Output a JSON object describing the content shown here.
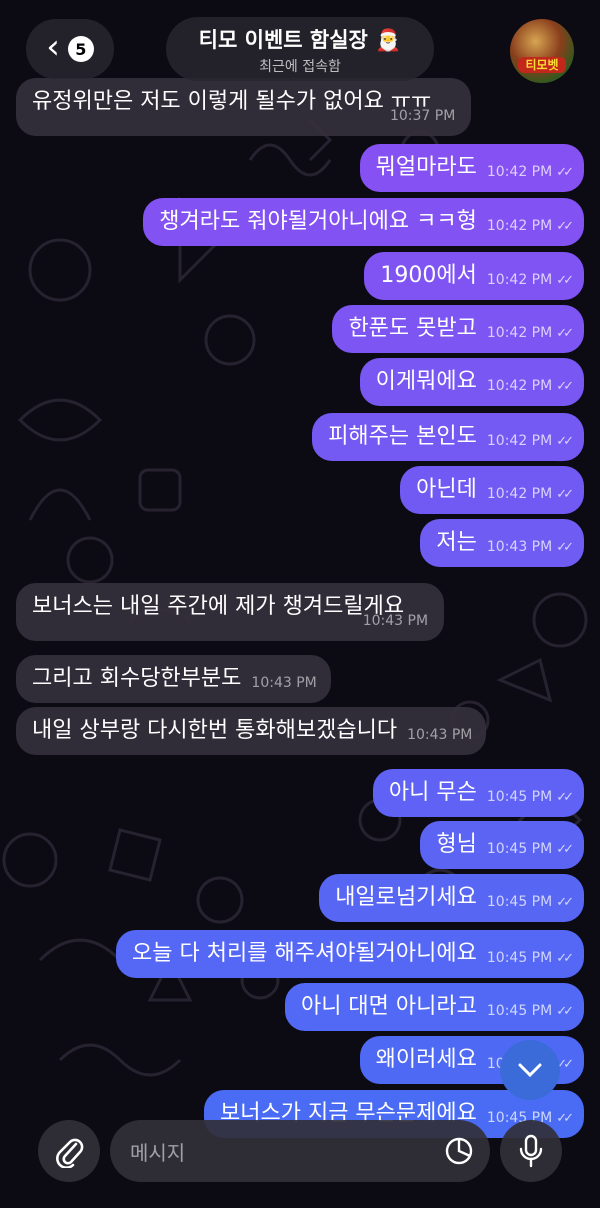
{
  "header": {
    "back_count": "5",
    "title": "티모 이벤트 함실장 🎅",
    "status": "최근에 접속함",
    "avatar_text": "티모벳"
  },
  "messages": [
    {
      "dir": "in",
      "text": "유정위만은 저도 이렇게 될수가 없어요 ㅠㅠ",
      "time": "10:37 PM"
    },
    {
      "dir": "out",
      "text": "뭐얼마라도",
      "time": "10:42 PM"
    },
    {
      "dir": "out",
      "text": "챙겨라도 줘야될거아니에요 ㅋㅋ형",
      "time": "10:42 PM"
    },
    {
      "dir": "out",
      "text": "1900에서",
      "time": "10:42 PM"
    },
    {
      "dir": "out",
      "text": "한푼도 못받고",
      "time": "10:42 PM"
    },
    {
      "dir": "out",
      "text": "이게뭐에요",
      "time": "10:42 PM"
    },
    {
      "dir": "out",
      "text": "피해주는 본인도",
      "time": "10:42 PM"
    },
    {
      "dir": "out",
      "text": "아닌데",
      "time": "10:42 PM"
    },
    {
      "dir": "out",
      "text": "저는",
      "time": "10:43 PM"
    },
    {
      "dir": "in",
      "text": "보너스는 내일 주간에 제가 챙겨드릴게요",
      "time": "10:43 PM"
    },
    {
      "dir": "in",
      "text": "그리고 회수당한부분도",
      "time": "10:43 PM"
    },
    {
      "dir": "in",
      "text": "내일 상부랑 다시한번 통화해보겠습니다",
      "time": "10:43 PM"
    },
    {
      "dir": "out",
      "text": "아니 무슨",
      "time": "10:45 PM"
    },
    {
      "dir": "out",
      "text": "형님",
      "time": "10:45 PM"
    },
    {
      "dir": "out",
      "text": "내일로넘기세요",
      "time": "10:45 PM"
    },
    {
      "dir": "out",
      "text": "오늘 다 처리를 해주셔야될거아니에요",
      "time": "10:45 PM"
    },
    {
      "dir": "out",
      "text": "아니 대면 아니라고",
      "time": "10:45 PM"
    },
    {
      "dir": "out",
      "text": "왜이러세요",
      "time": "10:45 PM"
    },
    {
      "dir": "out",
      "text": "보너스가 지금 무슨문제에요",
      "time": "10:45 PM"
    }
  ],
  "ticks": "✓✓",
  "composer": {
    "placeholder": "메시지"
  },
  "colors": {
    "out_top": "#8a4ff2",
    "out_bottom": "#4a6cf5",
    "incoming": "#34303c"
  }
}
